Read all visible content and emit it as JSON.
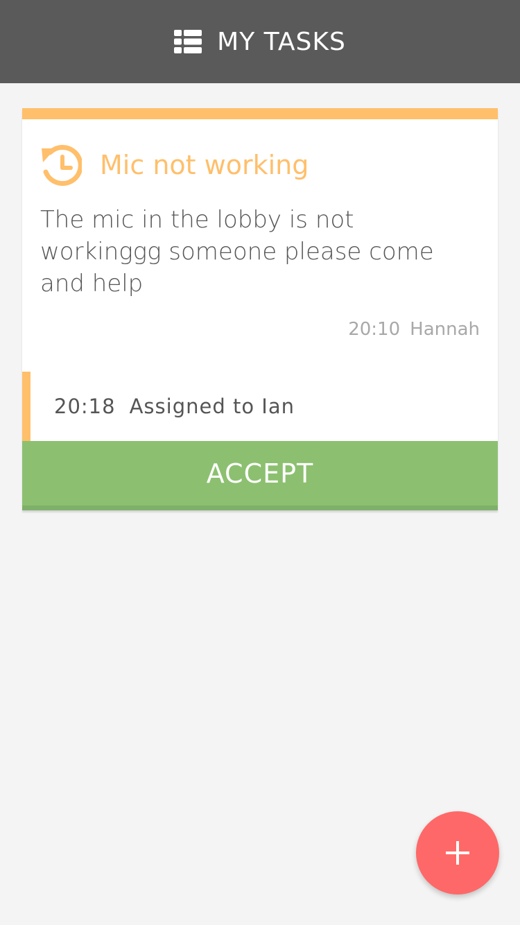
{
  "header": {
    "title": "MY TASKS",
    "icon": "list-icon"
  },
  "task": {
    "title": "Mic not working",
    "icon": "clock-history-icon",
    "description": "The mic in the lobby is not workinggg someone please come and help",
    "time": "20:10",
    "author": "Hannah",
    "assignment": {
      "time": "20:18",
      "text": "Assigned to Ian"
    },
    "accept_label": "ACCEPT"
  },
  "fab": {
    "icon": "plus-icon"
  },
  "colors": {
    "header_bg": "#5a5a5a",
    "accent_orange": "#ffbf6b",
    "accept_green": "#8cc070",
    "fab_red": "#ff6868",
    "page_bg": "#f4f4f4"
  }
}
